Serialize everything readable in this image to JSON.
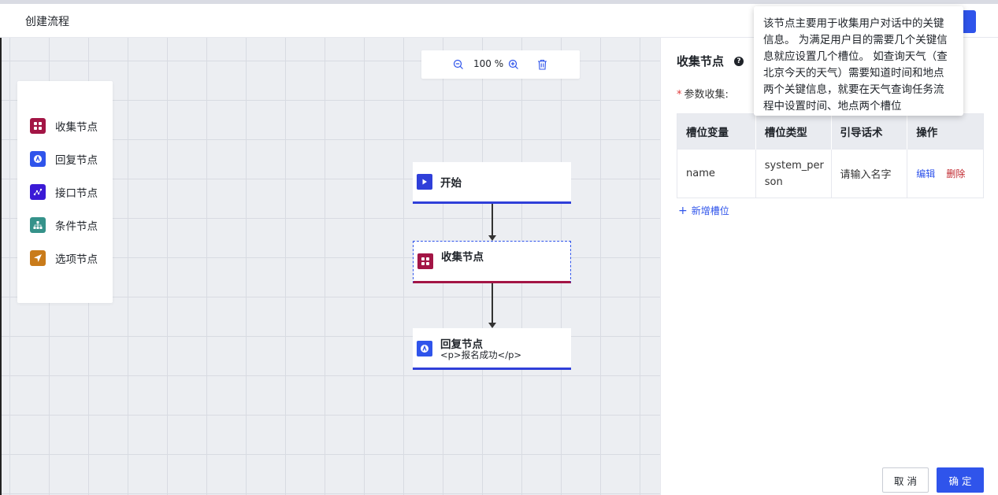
{
  "header": {
    "title": "创建流程"
  },
  "palette": {
    "items": [
      {
        "label": "收集节点",
        "icon": "grid-icon",
        "color": "#a31545"
      },
      {
        "label": "回复节点",
        "icon": "reply-icon",
        "color": "#2f54eb"
      },
      {
        "label": "接口节点",
        "icon": "api-icon",
        "color": "#3b1ad6"
      },
      {
        "label": "条件节点",
        "icon": "branch-icon",
        "color": "#35928a"
      },
      {
        "label": "选项节点",
        "icon": "send-icon",
        "color": "#c97b1a"
      }
    ]
  },
  "zoom": {
    "value": "100 %"
  },
  "flow": {
    "start": {
      "title": "开始"
    },
    "collect": {
      "title": "收集节点"
    },
    "reply": {
      "title": "回复节点",
      "subtitle": "<p>报名成功</p>"
    }
  },
  "panel": {
    "title": "收集节点",
    "required_mark": "*",
    "param_label": "参数收集:",
    "table": {
      "headers": [
        "槽位变量",
        "槽位类型",
        "引导话术",
        "操作"
      ],
      "rows": [
        {
          "variable": "name",
          "type": "system_person",
          "prompt": "请输入名字",
          "edit": "编辑",
          "delete": "删除"
        }
      ]
    },
    "add_slot": "新增槽位",
    "cancel_label": "取 消",
    "ok_label": "确 定"
  },
  "tooltip": {
    "text": "该节点主要用于收集用户对话中的关键信息。 为满足用户目的需要几个关键信息就应设置几个槽位。 如查询天气（查北京今天的天气）需要知道时间和地点两个关键信息，就要在天气查询任务流程中设置时间、地点两个槽位"
  },
  "colors": {
    "accent": "#2f54eb",
    "collect": "#a31545",
    "danger": "#c0262d"
  }
}
